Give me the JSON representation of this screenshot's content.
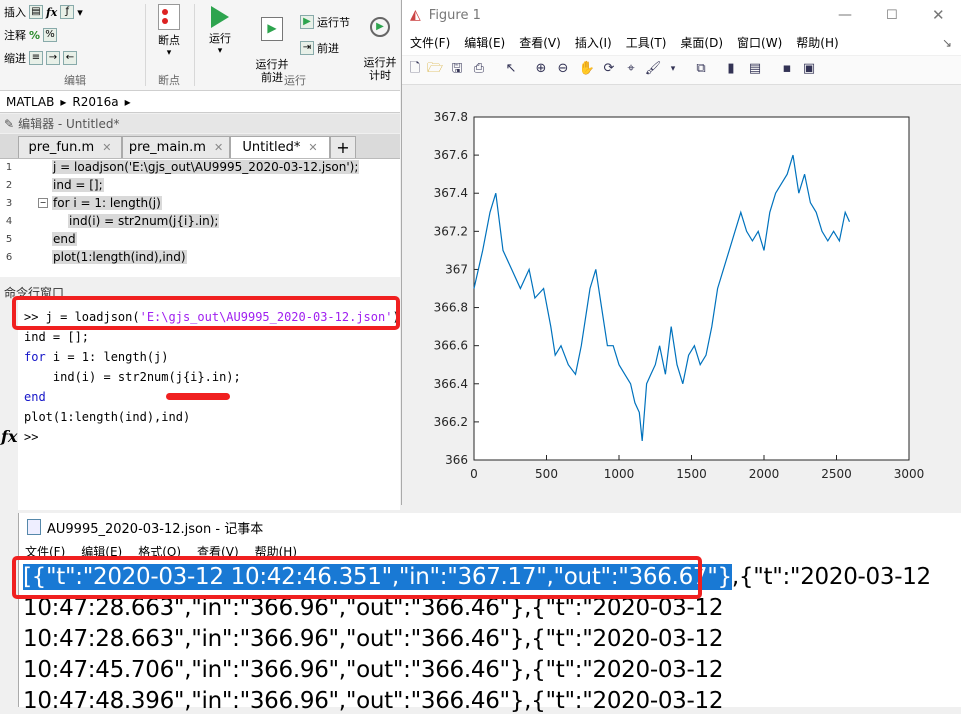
{
  "ribbon": {
    "insert": "插入",
    "comment": "注释",
    "indent": "缩进",
    "breakpoints": "断点",
    "run": "运行",
    "run_advance": "运行并\n前进",
    "run_section": "运行节",
    "advance": "前进",
    "run_time": "运行并\n计时",
    "group_edit": "编辑",
    "group_breakpoints": "断点",
    "group_run": "运行"
  },
  "address": {
    "root": "MATLAB",
    "folder": "R2016a"
  },
  "editor": {
    "title": "编辑器 - Untitled*",
    "tabs": [
      "pre_fun.m",
      "pre_main.m",
      "Untitled*"
    ],
    "add_tab": "+",
    "lines": [
      {
        "num": "1",
        "text": "j = loadjson('E:\\gjs_out\\AU9995_2020-03-12.json');"
      },
      {
        "num": "2",
        "text": "ind = [];"
      },
      {
        "num": "3",
        "text": "for i = 1: length(j)"
      },
      {
        "num": "4",
        "text": "ind(i) = str2num(j{i}.in);"
      },
      {
        "num": "5",
        "text": "end"
      },
      {
        "num": "6",
        "text": "plot(1:length(ind),ind)"
      }
    ]
  },
  "command_window": {
    "title": "命令行窗口",
    "prompt_line_prefix": ">> j = loadjson(",
    "prompt_line_string": "'E:\\gjs_out\\AU9995_2020-03-12.json'",
    "prompt_line_suffix": ")",
    "line2": "ind = [];",
    "line3_kw": "for",
    "line3_rest": " i = 1: length(j)",
    "line4": "    ind(i) = str2num(j{i}.in);",
    "line5_kw": "end",
    "line6": "plot(1:length(ind),ind)",
    "prompt": ">>",
    "fx": "fx"
  },
  "figure": {
    "title": "Figure 1",
    "menu": [
      "文件(F)",
      "编辑(E)",
      "查看(V)",
      "插入(I)",
      "工具(T)",
      "桌面(D)",
      "窗口(W)",
      "帮助(H)"
    ]
  },
  "chart_data": {
    "type": "line",
    "title": "",
    "xlabel": "",
    "ylabel": "",
    "xlim": [
      0,
      3000
    ],
    "ylim": [
      366,
      367.8
    ],
    "xticks": [
      0,
      500,
      1000,
      1500,
      2000,
      2500,
      3000
    ],
    "yticks": [
      366,
      366.2,
      366.4,
      366.6,
      366.8,
      367,
      367.2,
      367.4,
      367.6,
      367.8
    ],
    "grid": false,
    "color": "#0072bd",
    "series": [
      {
        "x": [
          0,
          60,
          110,
          150,
          200,
          260,
          320,
          380,
          420,
          480,
          530,
          560,
          600,
          650,
          700,
          740,
          780,
          800,
          840,
          880,
          920,
          960,
          1000,
          1040,
          1080,
          1110,
          1140,
          1160,
          1190,
          1220,
          1250,
          1280,
          1320,
          1360,
          1400,
          1440,
          1480,
          1520,
          1560,
          1600,
          1640,
          1680,
          1720,
          1760,
          1800,
          1840,
          1880,
          1920,
          1960,
          2000,
          2040,
          2080,
          2120,
          2160,
          2200,
          2240,
          2280,
          2320,
          2360,
          2400,
          2440,
          2480,
          2520,
          2560,
          2590
        ],
        "y": [
          366.9,
          367.1,
          367.3,
          367.4,
          367.1,
          367.0,
          366.9,
          367.0,
          366.85,
          366.9,
          366.7,
          366.55,
          366.6,
          366.5,
          366.45,
          366.6,
          366.8,
          366.9,
          367.0,
          366.8,
          366.6,
          366.6,
          366.5,
          366.45,
          366.4,
          366.3,
          366.25,
          366.1,
          366.4,
          366.45,
          366.5,
          366.6,
          366.45,
          366.7,
          366.5,
          366.4,
          366.55,
          366.6,
          366.5,
          366.55,
          366.7,
          366.9,
          367.0,
          367.1,
          367.2,
          367.3,
          367.2,
          367.15,
          367.2,
          367.1,
          367.3,
          367.4,
          367.45,
          367.5,
          367.6,
          367.4,
          367.5,
          367.35,
          367.3,
          367.2,
          367.15,
          367.2,
          367.15,
          367.3,
          367.25
        ]
      }
    ]
  },
  "notepad": {
    "title": "AU9995_2020-03-12.json - 记事本",
    "menu": [
      "文件(F)",
      "编辑(E)",
      "格式(O)",
      "查看(V)",
      "帮助(H)"
    ],
    "line1_selected": "[{\"t\":\"2020-03-12 10:42:46.351\",\"in\":\"367.17\",\"out\":\"366.67\"}",
    "line1_rest": ",{\"t\":\"2020-03-12",
    "lines": [
      "10:47:28.663\",\"in\":\"366.96\",\"out\":\"366.46\"},{\"t\":\"2020-03-12",
      "10:47:28.663\",\"in\":\"366.96\",\"out\":\"366.46\"},{\"t\":\"2020-03-12",
      "10:47:45.706\",\"in\":\"366.96\",\"out\":\"366.46\"},{\"t\":\"2020-03-12",
      "10:47:48.396\",\"in\":\"366.96\",\"out\":\"366.46\"},{\"t\":\"2020-03-12"
    ]
  }
}
